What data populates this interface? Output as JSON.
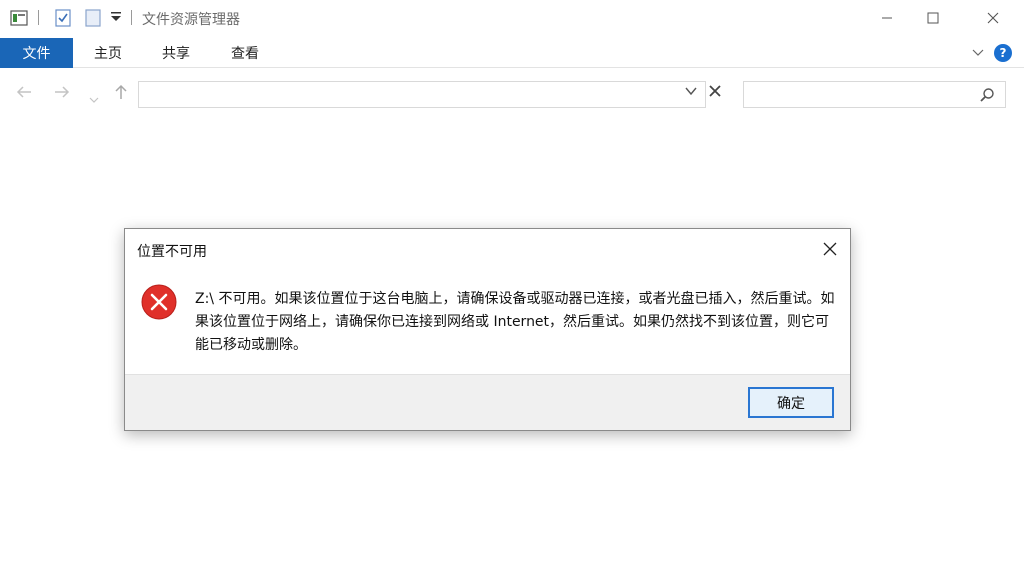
{
  "titlebar": {
    "title": "文件资源管理器"
  },
  "ribbon": {
    "tabs": [
      {
        "label": "文件"
      },
      {
        "label": "主页"
      },
      {
        "label": "共享"
      },
      {
        "label": "查看"
      }
    ],
    "help_label": "?"
  },
  "address": {
    "path": "",
    "search_placeholder": ""
  },
  "dialog": {
    "title": "位置不可用",
    "message": "Z:\\ 不可用。如果该位置位于这台电脑上，请确保设备或驱动器已连接，或者光盘已插入，然后重试。如果该位置位于网络上，请确保你已连接到网络或 Internet，然后重试。如果仍然找不到该位置，则它可能已移动或删除。",
    "ok_label": "确定"
  },
  "colors": {
    "file_tab": "#1a66b7",
    "error_red": "#e0302a",
    "ok_border": "#2a76d2",
    "help_blue": "#1a6fd0"
  },
  "icons": [
    "explorer-properties-icon",
    "checkmark-doc-icon",
    "new-folder-icon",
    "dropdown-icon",
    "minimize-icon",
    "maximize-icon",
    "close-icon",
    "back-arrow-icon",
    "forward-arrow-icon",
    "recent-chevron-icon",
    "up-arrow-icon",
    "search-icon",
    "error-icon"
  ]
}
